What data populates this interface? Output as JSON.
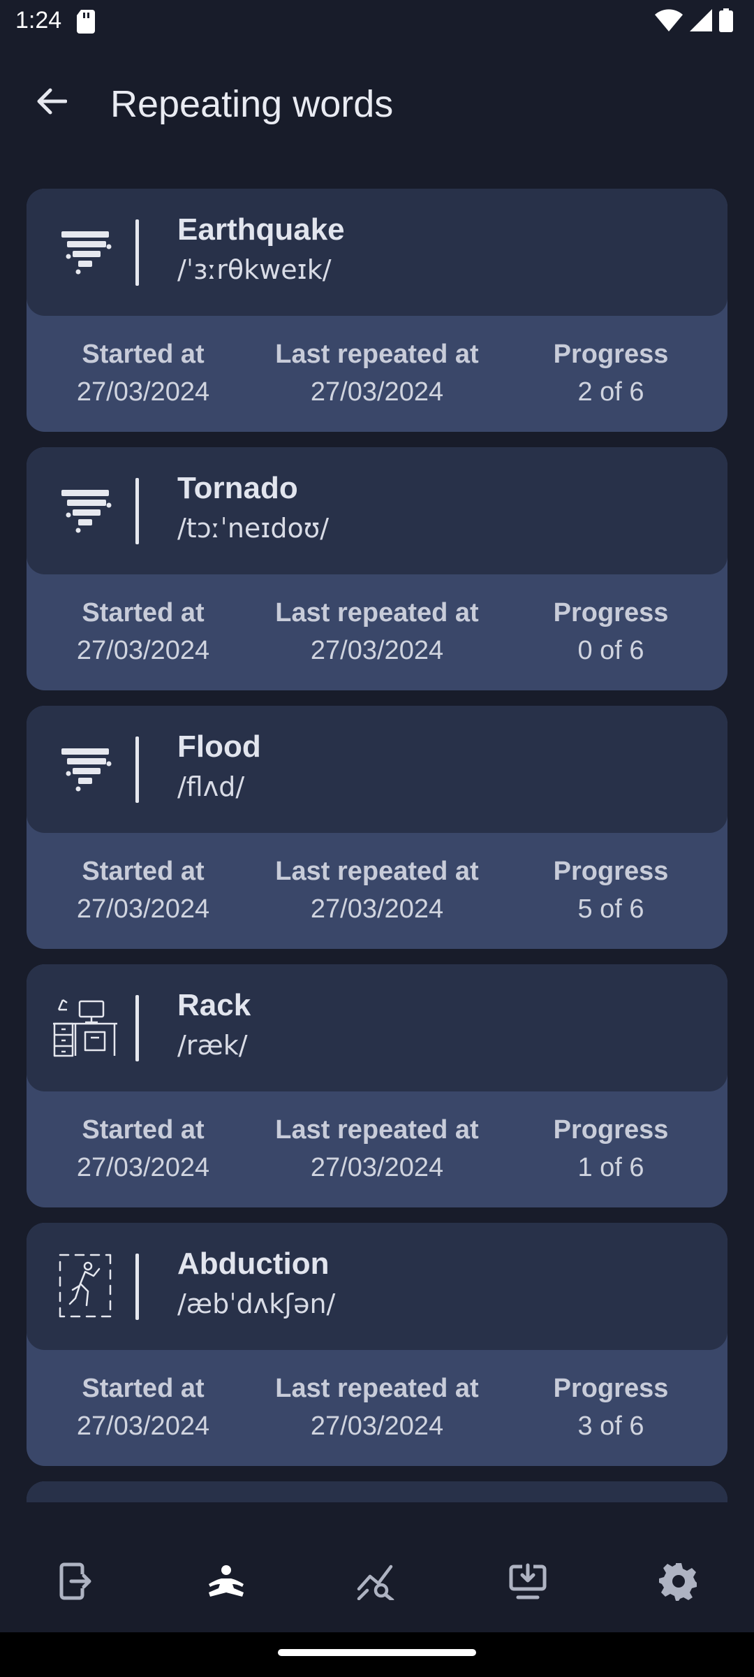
{
  "status_bar": {
    "time": "1:24",
    "icons": [
      "sd-card-icon",
      "wifi-icon",
      "signal-icon",
      "battery-icon"
    ]
  },
  "app_bar": {
    "title": "Repeating words",
    "back_icon": "arrow-back-icon"
  },
  "words": [
    {
      "word": "Earthquake",
      "phonetic": "/ˈɜːrθkweɪk/",
      "icon": "tornado-icon",
      "started_label": "Started at",
      "started": "27/03/2024",
      "last_label": "Last repeated at",
      "last": "27/03/2024",
      "progress_label": "Progress",
      "progress": "2 of 6"
    },
    {
      "word": "Tornado",
      "phonetic": "/tɔːˈneɪdoʊ/",
      "icon": "tornado-icon",
      "started_label": "Started at",
      "started": "27/03/2024",
      "last_label": "Last repeated at",
      "last": "27/03/2024",
      "progress_label": "Progress",
      "progress": "0 of 6"
    },
    {
      "word": "Flood",
      "phonetic": "/flʌd/",
      "icon": "tornado-icon",
      "started_label": "Started at",
      "started": "27/03/2024",
      "last_label": "Last repeated at",
      "last": "27/03/2024",
      "progress_label": "Progress",
      "progress": "5 of 6"
    },
    {
      "word": "Rack",
      "phonetic": "/ræk/",
      "icon": "desk-icon",
      "started_label": "Started at",
      "started": "27/03/2024",
      "last_label": "Last repeated at",
      "last": "27/03/2024",
      "progress_label": "Progress",
      "progress": "1 of 6"
    },
    {
      "word": "Abduction",
      "phonetic": "/æbˈdʌkʃən/",
      "icon": "person-framed-icon",
      "started_label": "Started at",
      "started": "27/03/2024",
      "last_label": "Last repeated at",
      "last": "27/03/2024",
      "progress_label": "Progress",
      "progress": "3 of 6"
    }
  ],
  "bottom_nav": {
    "items": [
      {
        "icon": "exit-icon",
        "active": false
      },
      {
        "icon": "meditation-icon",
        "active": true
      },
      {
        "icon": "chart-search-icon",
        "active": false
      },
      {
        "icon": "download-icon",
        "active": false
      },
      {
        "icon": "gear-icon",
        "active": false
      }
    ]
  },
  "colors": {
    "background": "#181c2a",
    "card_head": "#283149",
    "card_body": "#3a4769",
    "text": "#e6e8ef"
  }
}
